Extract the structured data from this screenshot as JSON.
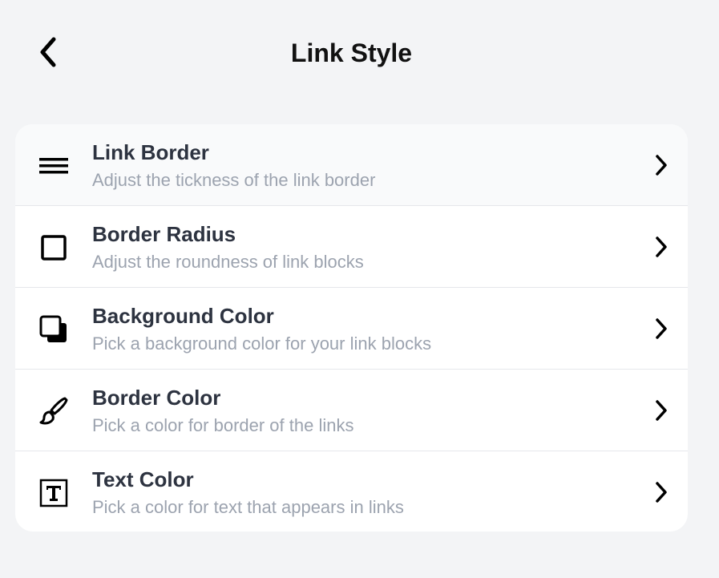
{
  "header": {
    "title": "Link Style",
    "back_icon": "chevron-left-icon"
  },
  "items": [
    {
      "title": "Link Border",
      "subtitle": "Adjust the tickness of the link border",
      "icon": "menu-lines-icon"
    },
    {
      "title": "Border Radius",
      "subtitle": "Adjust the roundness of link blocks",
      "icon": "square-outline-icon"
    },
    {
      "title": "Background Color",
      "subtitle": "Pick a background color for your link blocks",
      "icon": "layered-squares-icon"
    },
    {
      "title": "Border Color",
      "subtitle": "Pick a color for border of the links",
      "icon": "paintbrush-icon"
    },
    {
      "title": "Text Color",
      "subtitle": "Pick a color for text that appears in links",
      "icon": "text-box-icon"
    }
  ],
  "colors": {
    "background": "#f3f4f6",
    "card": "#ffffff",
    "title_text": "#2d3340",
    "subtitle_text": "#9ca3af",
    "divider": "#e5e7eb"
  }
}
